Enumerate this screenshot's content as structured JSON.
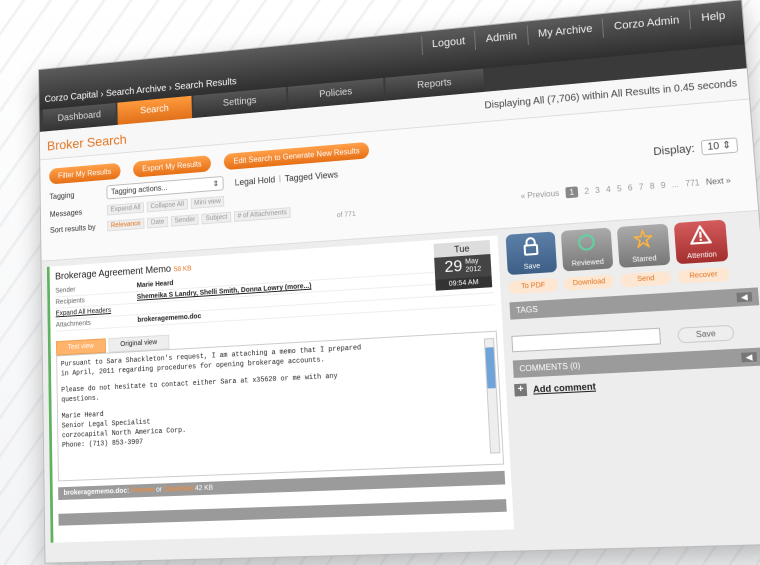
{
  "topnav": [
    "Logout",
    "Admin",
    "My Archive",
    "Corzo Admin",
    "Help"
  ],
  "breadcrumb": "Corzo Capital › Search Archive › Search Results",
  "tabs": [
    "Dashboard",
    "Search",
    "Settings",
    "Policies",
    "Reports"
  ],
  "header": {
    "title": "Broker Search",
    "displaying": "Displaying All (7,706) within All Results in 0.45 seconds"
  },
  "controls": {
    "buttons": [
      "Filter My Results",
      "Export My Results",
      "Edit Search to Generate New Results"
    ],
    "tagging_label": "Tagging",
    "tagging_select": "Tagging actions...",
    "legal_hold": "Legal Hold",
    "tagged_views": "Tagged Views",
    "messages_label": "Messages",
    "expand_all": "Expand All",
    "collapse_all": "Collapse All",
    "mini_view": "Mini view",
    "sort_label": "Sort results by",
    "sort_opts": [
      "Relevance",
      "Date",
      "Sender",
      "Subject",
      "# of Attachments"
    ],
    "display_label": "Display:",
    "display_value": "10",
    "of_pages": "of 771",
    "pager": {
      "prev": "« Previous",
      "pages": [
        "1",
        "2",
        "3",
        "4",
        "5",
        "6",
        "7",
        "8",
        "9",
        "...",
        "771"
      ],
      "next": "Next »"
    }
  },
  "email": {
    "subject": "Brokerage Agreement Memo",
    "size": "58 KB",
    "sender_label": "Sender",
    "sender": "Marie Heard",
    "recipients_label": "Recipients",
    "recipients": "Shemeika S Landry, Shelli Smith, Donna Lowry (more...)",
    "expand_headers": "Expand All Headers",
    "attachments_label": "Attachments",
    "attachment": "brokeragememo.doc",
    "date": {
      "dow": "Tue",
      "day": "29",
      "month": "May",
      "year": "2012",
      "time": "09:54 AM"
    },
    "tabs": [
      "Text view",
      "Original view"
    ],
    "body": [
      "Pursuant to Sara Shackleton's request, I am attaching a memo that I prepared\nin April, 2011 regarding procedures for opening brokerage accounts.",
      "Please do not hesitate to contact either Sara at x35620 or me with any\nquestions.",
      "Marie Heard\nSenior Legal Specialist\ncorzocapital North America Corp.\nPhone: (713) 853-3907"
    ],
    "attach_bar": {
      "file": "brokeragememo.doc:",
      "view": "Preview",
      "or": "or",
      "download": "Download",
      "size": "42 KB"
    }
  },
  "actions": [
    "Save",
    "Reviewed",
    "Starred",
    "Attention"
  ],
  "action_buttons": [
    "To PDF",
    "Download",
    "Send",
    "Recover"
  ],
  "tags_title": "TAGS",
  "tags_save": "Save",
  "comments_title": "COMMENTS (0)",
  "add_comment": "Add comment"
}
